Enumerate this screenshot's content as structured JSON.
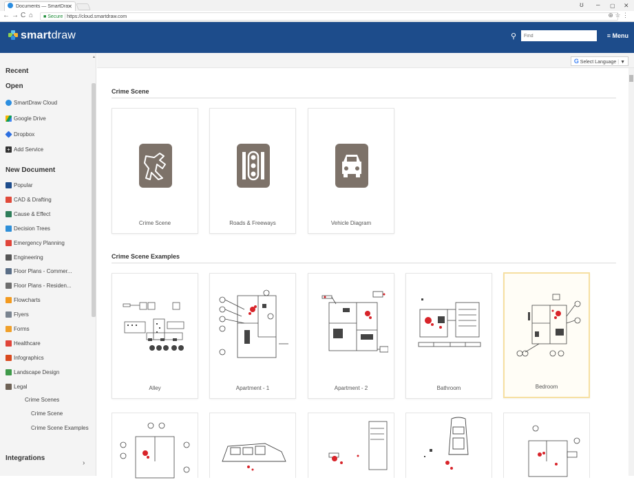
{
  "browser": {
    "tab_title": "Documents — SmartDra",
    "tab_close": "✕",
    "url_secure": "Secure",
    "url": "https://cloud.smartdraw.com",
    "win_min": "–",
    "win_max": "▢",
    "win_close": "✕",
    "profile_glyph": "ʊ"
  },
  "header": {
    "logo_prefix": "smart",
    "logo_suffix": "draw",
    "search_placeholder": "Find",
    "menu_label": "≡ Menu",
    "bg_color": "#1d4c8b"
  },
  "sidebar": {
    "recent": "Recent",
    "open": "Open",
    "open_items": [
      {
        "label": "SmartDraw Cloud",
        "icon": "smartdraw-cloud-icon",
        "color": "#2d8fe0"
      },
      {
        "label": "Google Drive",
        "icon": "google-drive-icon",
        "color": "#f4b400"
      },
      {
        "label": "Dropbox",
        "icon": "dropbox-icon",
        "color": "#2d6fe0"
      },
      {
        "label": "Add Service",
        "icon": "add-service-icon",
        "color": "#333333"
      }
    ],
    "new_document": "New Document",
    "categories": [
      {
        "label": "Popular",
        "color": "#1d4c8b"
      },
      {
        "label": "CAD & Drafting",
        "color": "#e04a3a"
      },
      {
        "label": "Cause & Effect",
        "color": "#2f7e5a"
      },
      {
        "label": "Decision Trees",
        "color": "#2f8fd8"
      },
      {
        "label": "Emergency Planning",
        "color": "#e0453a"
      },
      {
        "label": "Engineering",
        "color": "#555555"
      },
      {
        "label": "Floor Plans - Commer...",
        "color": "#5a6e86"
      },
      {
        "label": "Floor Plans - Residen...",
        "color": "#6e6e6e"
      },
      {
        "label": "Flowcharts",
        "color": "#f39a1f"
      },
      {
        "label": "Flyers",
        "color": "#7a8490"
      },
      {
        "label": "Forms",
        "color": "#f0a02a"
      },
      {
        "label": "Healthcare",
        "color": "#e0453a"
      },
      {
        "label": "Infographics",
        "color": "#d94a1f"
      },
      {
        "label": "Landscape Design",
        "color": "#3f9a4a"
      },
      {
        "label": "Legal",
        "color": "#6e6256"
      }
    ],
    "sub_items": [
      "Crime Scenes",
      "Crime Scene",
      "Crime Scene Examples"
    ],
    "integrations": "Integrations",
    "integrations_caret": "›"
  },
  "main": {
    "select_language": "Select Language",
    "select_language_arrow": "▼",
    "sections": [
      {
        "title": "Crime Scene",
        "cards": [
          {
            "label": "Crime Scene",
            "icon": "chalk-outline-icon"
          },
          {
            "label": "Roads & Freeways",
            "icon": "traffic-light-icon"
          },
          {
            "label": "Vehicle Diagram",
            "icon": "car-icon"
          }
        ]
      },
      {
        "title": "Crime Scene Examples",
        "cards": [
          {
            "label": "Alley"
          },
          {
            "label": "Apartment - 1"
          },
          {
            "label": "Apartment - 2"
          },
          {
            "label": "Bathroom"
          },
          {
            "label": "Bedroom"
          }
        ]
      }
    ]
  },
  "colors": {
    "tile_bg": "#7d7269",
    "selected_border": "#f6dfa0",
    "blood_red": "#d8242a"
  }
}
